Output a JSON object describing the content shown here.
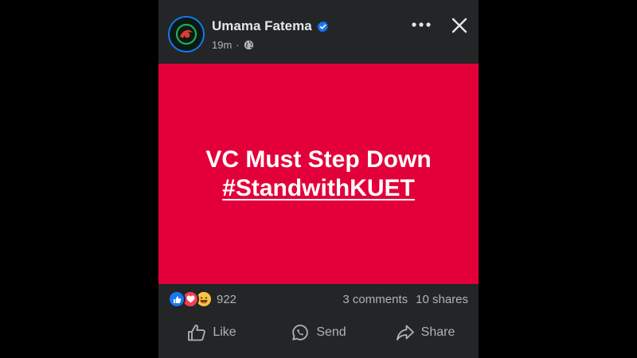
{
  "post": {
    "author_name": "Umama Fatema",
    "time": "19m",
    "separator": "·",
    "image_line1": "VC Must Step Down",
    "image_line2": "#StandwithKUET",
    "image_background": "#e3003a"
  },
  "header": {
    "more_icon": "more-dots-icon",
    "close_icon": "close-icon"
  },
  "reactions": {
    "count": "922",
    "types": [
      "like",
      "love",
      "haha"
    ]
  },
  "stats": {
    "comments": "3 comments",
    "shares": "10 shares"
  },
  "actions": {
    "like": "Like",
    "send": "Send",
    "share": "Share"
  },
  "colors": {
    "panel": "#242526",
    "accent": "#1877f2",
    "text_primary": "#e4e6eb",
    "text_secondary": "#b0b3b8"
  }
}
